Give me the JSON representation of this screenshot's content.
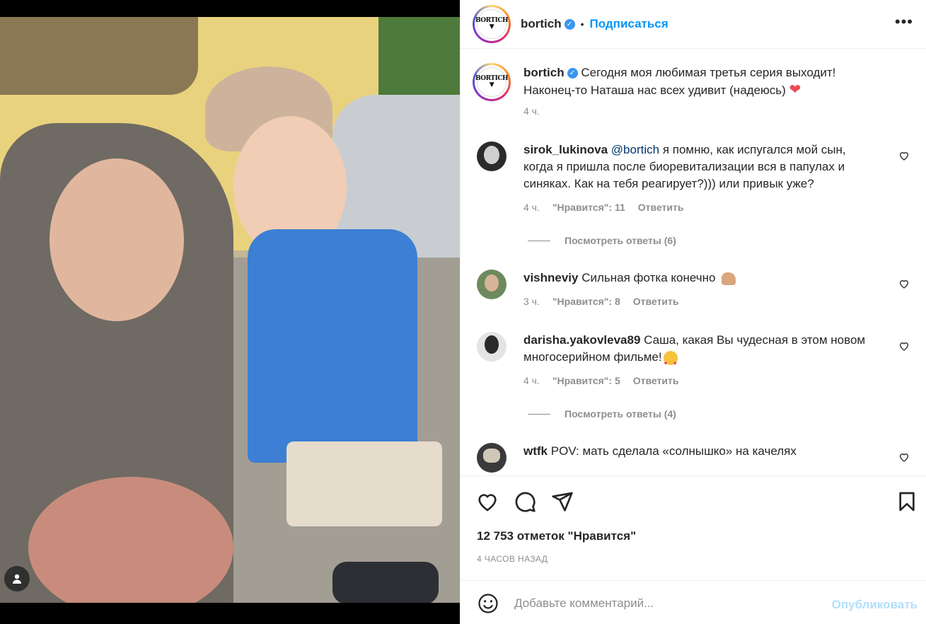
{
  "post": {
    "username": "bortich",
    "follow_label": "Подписаться",
    "more_label": "•••",
    "caption_line1": "Сегодня моя любимая третья серия выходит!",
    "caption_line2": "Наконец-то Наташа нас всех удивит (надеюсь)",
    "caption_time": "4 ч.",
    "logo_text_top": "BORTICH",
    "logo_text_mid": "▼"
  },
  "comments": [
    {
      "user": "sirok_lukinova",
      "mention": "@bortich",
      "text_lines": [
        "я помню, как испугался мой сын,",
        "когда я пришла после биоревитализации вся в папулах и",
        "синяках. Как на тебя реагирует?))) или привык уже?"
      ],
      "time": "4 ч.",
      "likes": "\"Нравится\": 11",
      "reply": "Ответить",
      "view_replies": "Посмотреть ответы (6)"
    },
    {
      "user": "vishneviy",
      "text": "Сильная фотка конечно",
      "time": "3 ч.",
      "likes": "\"Нравится\": 8",
      "reply": "Ответить"
    },
    {
      "user": "darisha.yakovleva89",
      "text_lines": [
        "Саша, какая Вы чудесная в этом новом",
        "многосерийном фильме!"
      ],
      "time": "4 ч.",
      "likes": "\"Нравится\": 5",
      "reply": "Ответить",
      "view_replies": "Посмотреть ответы (4)"
    },
    {
      "user": "wtfk",
      "text": "POV: мать сделала «солнышко» на качелях"
    }
  ],
  "footer": {
    "likes_count": "12 753 отметок \"Нравится\"",
    "time_ago": "4 ЧАСОВ НАЗАД",
    "comment_placeholder": "Добавьте комментарий...",
    "publish_label": "Опубликовать"
  },
  "colors": {
    "accent": "#0095f6",
    "verified": "#3897f0",
    "muted": "#8e8e8e",
    "heart_red": "#ed4956"
  }
}
